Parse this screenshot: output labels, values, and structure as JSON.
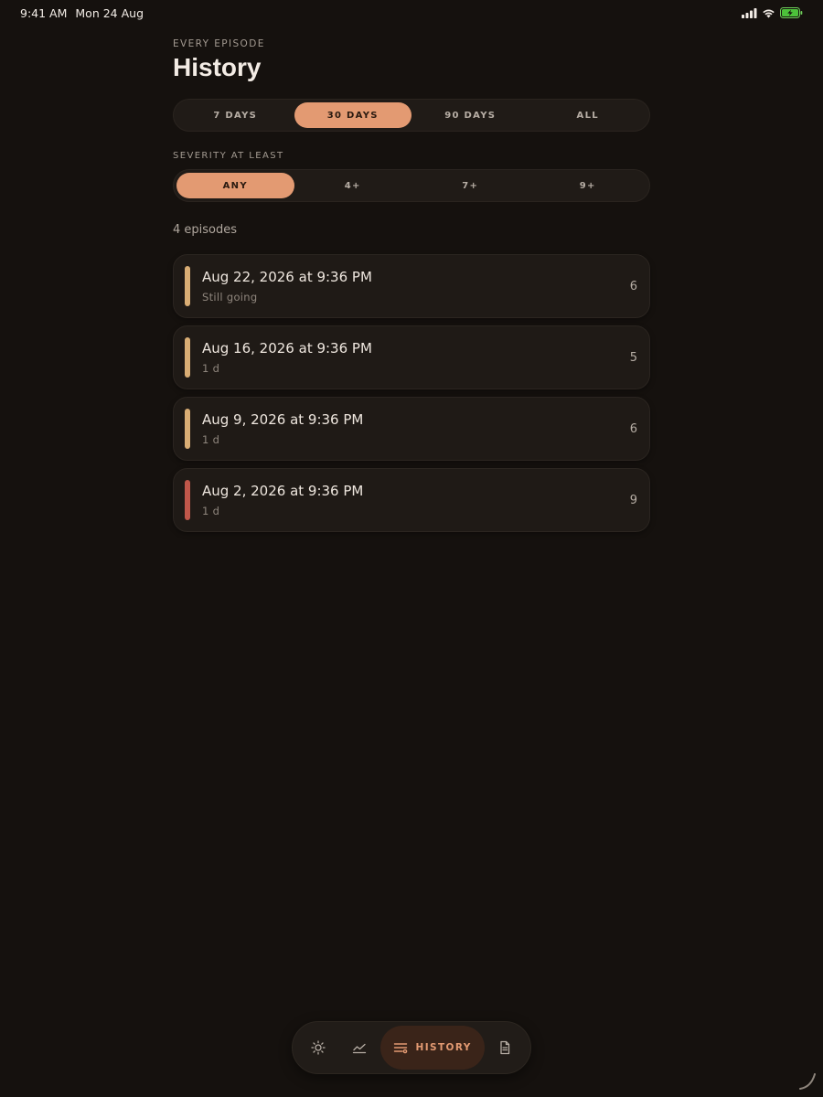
{
  "status_bar": {
    "time": "9:41 AM",
    "date": "Mon 24 Aug"
  },
  "header": {
    "eyebrow": "EVERY EPISODE",
    "title": "History"
  },
  "range_filter": {
    "options": [
      "7 DAYS",
      "30 DAYS",
      "90 DAYS",
      "ALL"
    ],
    "selected": "30 DAYS"
  },
  "severity_filter": {
    "label": "SEVERITY AT LEAST",
    "options": [
      "ANY",
      "4+",
      "7+",
      "9+"
    ],
    "selected": "ANY"
  },
  "episode_count": "4 episodes",
  "episodes": [
    {
      "date": "Aug 22, 2026 at 9:36 PM",
      "duration": "Still going",
      "score": "6",
      "color": "#d9ad74"
    },
    {
      "date": "Aug 16, 2026 at 9:36 PM",
      "duration": "1 d",
      "score": "5",
      "color": "#d9ad74"
    },
    {
      "date": "Aug 9, 2026 at 9:36 PM",
      "duration": "1 d",
      "score": "6",
      "color": "#d9ad74"
    },
    {
      "date": "Aug 2, 2026 at 9:36 PM",
      "duration": "1 d",
      "score": "9",
      "color": "#c0574a"
    }
  ],
  "tabbar": {
    "tabs": [
      {
        "icon": "sun-icon"
      },
      {
        "icon": "trend-icon"
      },
      {
        "icon": "list-icon",
        "label": "HISTORY",
        "active": true
      },
      {
        "icon": "document-icon"
      }
    ]
  },
  "colors": {
    "background": "#15110e",
    "accent": "#e39a72",
    "card": "#1f1a16",
    "moderate": "#d9ad74",
    "severe": "#c0574a"
  }
}
